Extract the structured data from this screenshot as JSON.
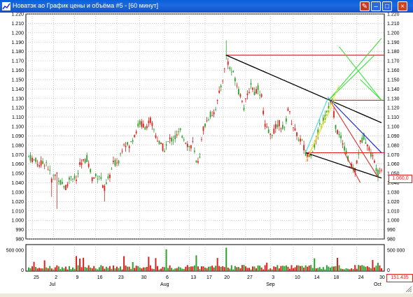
{
  "window": {
    "title": "Новатэк ао График цены и объёма #5 - [60 минут]",
    "buttons": {
      "pin": "✎",
      "min": "–",
      "max": "□",
      "close": "×"
    }
  },
  "colors": {
    "up": "#2ea02e",
    "down": "#e0201c",
    "grid": "#aaaaaa",
    "trend_black": "#000000",
    "trend_blue": "#1c2ee0",
    "hline_red": "#e0201c",
    "fan_green": "#30e030",
    "fan_yellow": "#e8e040",
    "fan_cyan": "#30d8e8"
  },
  "price_axis": {
    "ticks": [
      "1.220",
      "1.210",
      "1.200",
      "1.190",
      "1.180",
      "1.170",
      "1.160",
      "1.150",
      "1.140",
      "1.130",
      "1.120",
      "1.110",
      "1.100",
      "1.090",
      "1.080",
      "1.070",
      "1.060",
      "1.050",
      "1.040",
      "1.030",
      "1.020",
      "1.010",
      "1.000",
      "990",
      "980"
    ],
    "min": 980,
    "max": 1220,
    "current_value": "1.060,0"
  },
  "volume_axis": {
    "ticks": [
      "500 000",
      "0"
    ],
    "max": 600000,
    "current_value": "151.435"
  },
  "date_axis": {
    "day_labels": [
      "25",
      "2",
      "9",
      "16",
      "23",
      "30",
      "6",
      "13",
      "17",
      "20",
      "27",
      "3",
      "10",
      "14",
      "18",
      "24",
      "30"
    ],
    "month_labels": [
      "Jul",
      "Aug",
      "Sep",
      "Oct"
    ]
  },
  "chart_data": {
    "type": "candlestick",
    "series": [
      {
        "name": "price",
        "points": [
          [
            0,
            1068
          ],
          [
            6,
            1060
          ],
          [
            10,
            1062
          ],
          [
            13,
            1044
          ],
          [
            16,
            1050
          ],
          [
            18,
            1040
          ],
          [
            21,
            1035
          ],
          [
            24,
            1048
          ],
          [
            27,
            1042
          ],
          [
            29,
            1058
          ],
          [
            33,
            1066
          ],
          [
            36,
            1045
          ],
          [
            40,
            1048
          ],
          [
            43,
            1033
          ],
          [
            46,
            1048
          ],
          [
            48,
            1060
          ],
          [
            51,
            1064
          ],
          [
            54,
            1084
          ],
          [
            57,
            1078
          ],
          [
            60,
            1092
          ],
          [
            63,
            1104
          ],
          [
            66,
            1100
          ],
          [
            69,
            1106
          ],
          [
            71,
            1096
          ],
          [
            74,
            1082
          ],
          [
            77,
            1076
          ],
          [
            80,
            1086
          ],
          [
            83,
            1088
          ],
          [
            86,
            1094
          ],
          [
            89,
            1085
          ],
          [
            91,
            1078
          ],
          [
            93,
            1082
          ],
          [
            95,
            1060
          ],
          [
            97,
            1070
          ],
          [
            99,
            1098
          ],
          [
            102,
            1110
          ],
          [
            105,
            1116
          ],
          [
            107,
            1126
          ],
          [
            109,
            1143
          ],
          [
            111,
            1160
          ],
          [
            112,
            1176
          ],
          [
            114,
            1162
          ],
          [
            117,
            1152
          ],
          [
            119,
            1138
          ],
          [
            121,
            1130
          ],
          [
            122,
            1120
          ],
          [
            124,
            1132
          ],
          [
            126,
            1146
          ],
          [
            128,
            1136
          ],
          [
            130,
            1142
          ],
          [
            132,
            1132
          ],
          [
            134,
            1100
          ],
          [
            137,
            1090
          ],
          [
            139,
            1096
          ],
          [
            142,
            1104
          ],
          [
            145,
            1096
          ],
          [
            147,
            1120
          ],
          [
            149,
            1106
          ],
          [
            152,
            1090
          ],
          [
            155,
            1084
          ],
          [
            157,
            1070
          ],
          [
            160,
            1072
          ],
          [
            163,
            1084
          ],
          [
            165,
            1102
          ],
          [
            168,
            1110
          ],
          [
            170,
            1122
          ],
          [
            172,
            1126
          ],
          [
            174,
            1100
          ],
          [
            176,
            1090
          ],
          [
            178,
            1084
          ],
          [
            180,
            1072
          ],
          [
            182,
            1058
          ],
          [
            185,
            1054
          ],
          [
            188,
            1082
          ],
          [
            190,
            1090
          ],
          [
            193,
            1076
          ],
          [
            196,
            1062
          ],
          [
            198,
            1050
          ],
          [
            200,
            1057
          ]
        ]
      }
    ],
    "ylim": [
      980,
      1220
    ],
    "drawings": {
      "horizontal_lines": [
        1176,
        1128,
        1072
      ],
      "trendlines": [
        "black upper channel",
        "black lower channel",
        "blue",
        "red",
        "green fan",
        "yellow fan",
        "cyan fan"
      ]
    }
  }
}
